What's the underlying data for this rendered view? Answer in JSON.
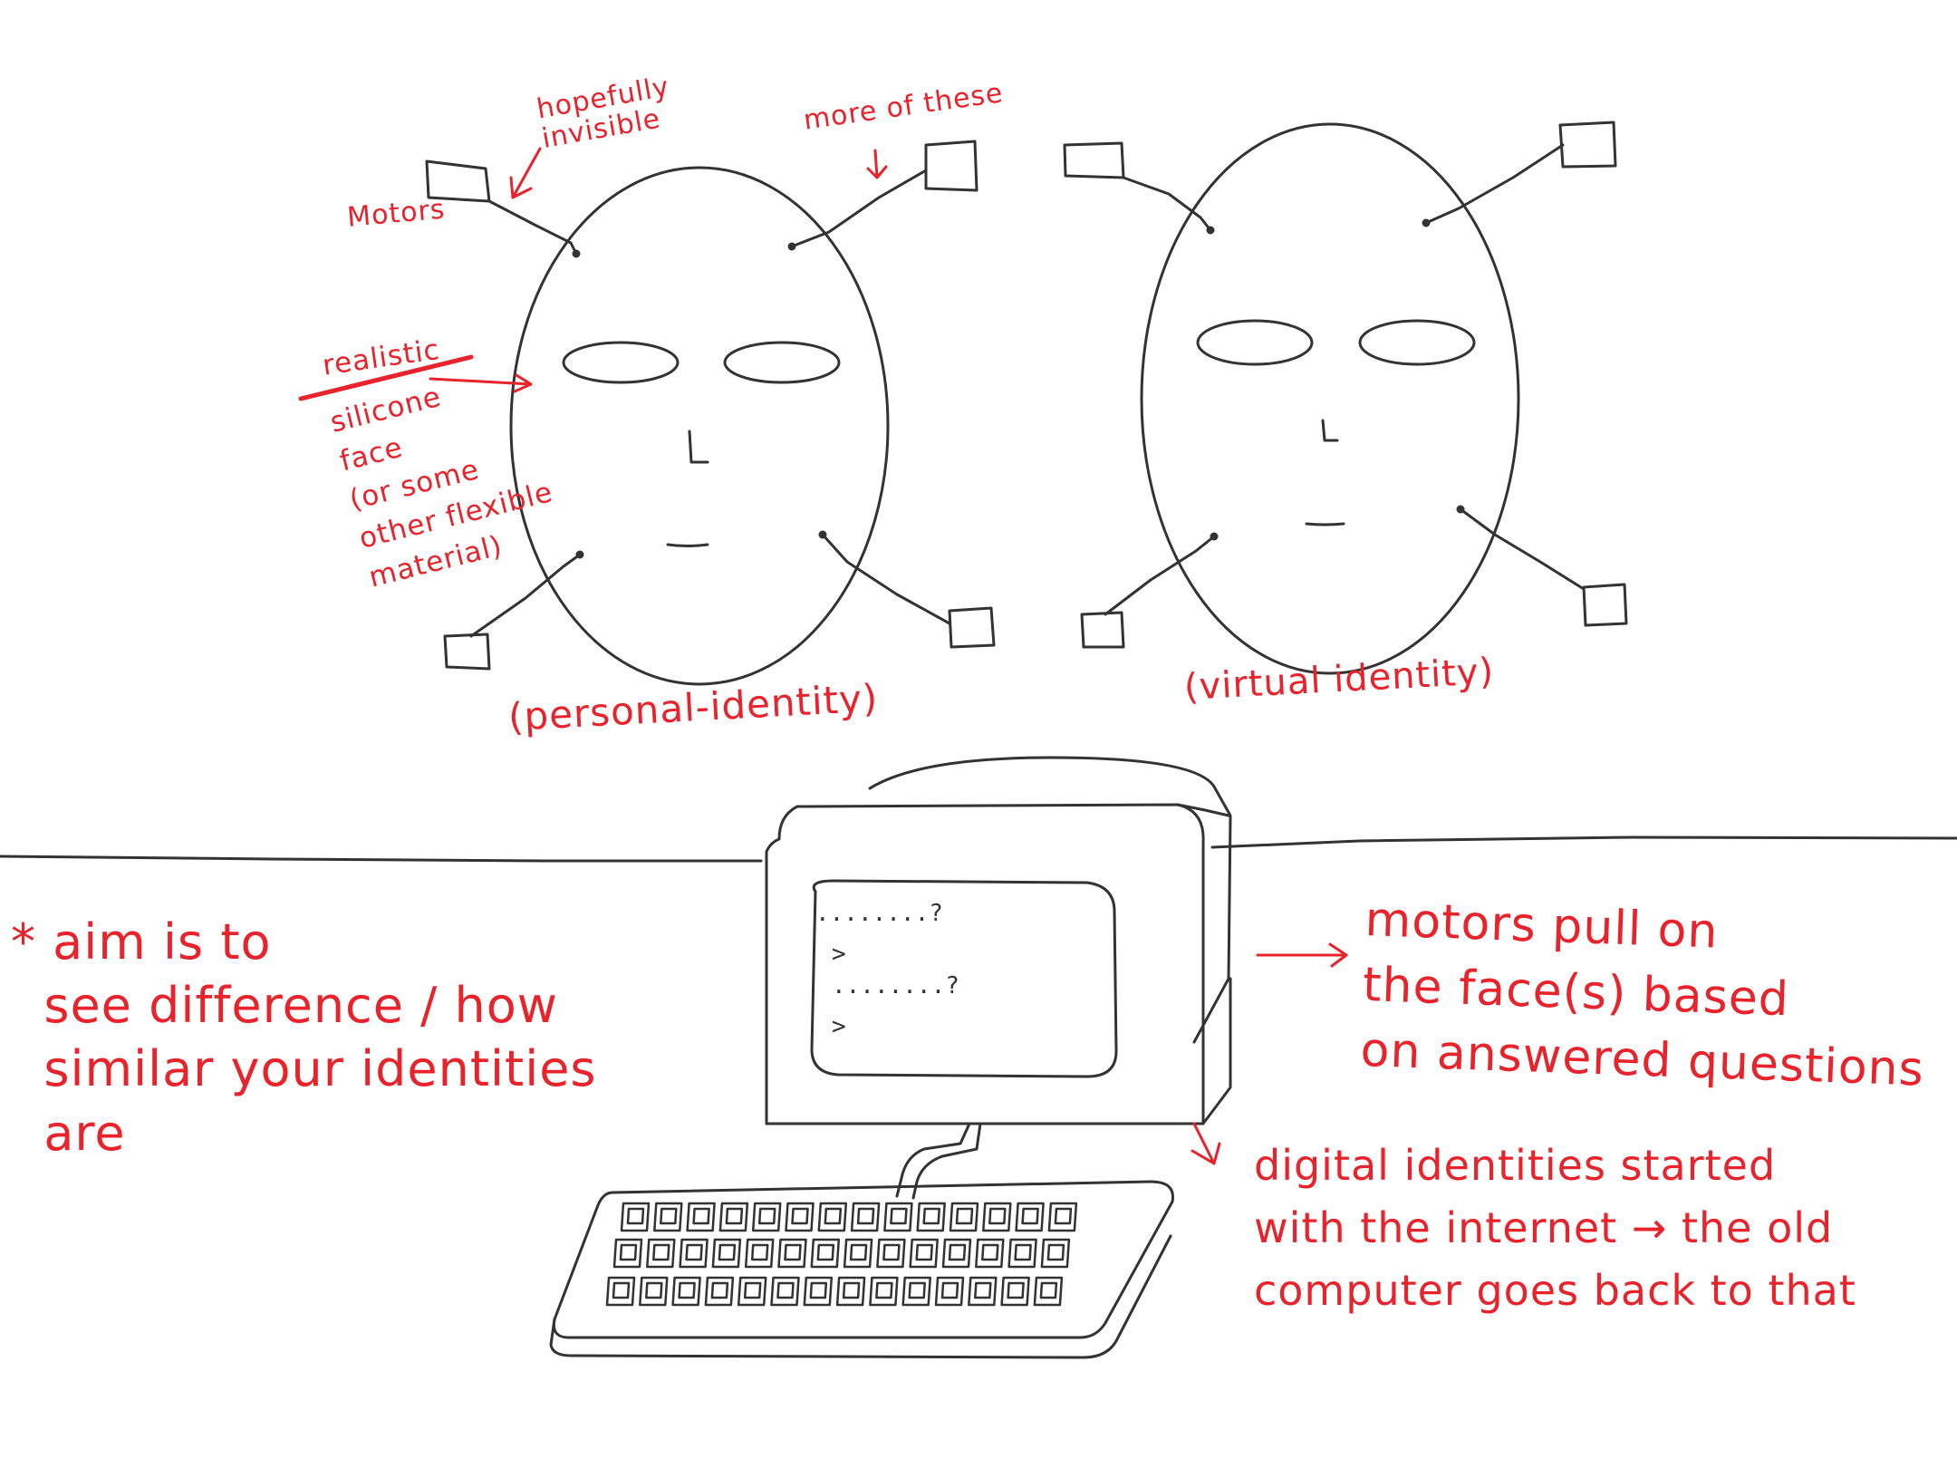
{
  "colors": {
    "ink": "#333333",
    "annotation": "#e8232b",
    "paper": "#ffffff"
  },
  "faces": {
    "personal_caption": "(personal-identity)",
    "virtual_caption": "(virtual identity)"
  },
  "annotations": {
    "hopefully_invisible": "hopefully\ninvisible",
    "more_of_these": "more of these",
    "motors": "Motors",
    "realistic": "realistic",
    "silicone_face": "silicone\nface\n(or some\nother flexible\nmaterial)"
  },
  "notes": {
    "aim": "* aim is to\n  see difference / how\n  similar your identities\n  are",
    "motors_pull": "motors pull on\nthe face(s) based\non answered questions",
    "digital_identities": "digital identities started\nwith the internet → the old\ncomputer goes back to that"
  },
  "screen": {
    "line1": "........?",
    "prompt1": ">",
    "line2": "........?",
    "prompt2": ">"
  }
}
